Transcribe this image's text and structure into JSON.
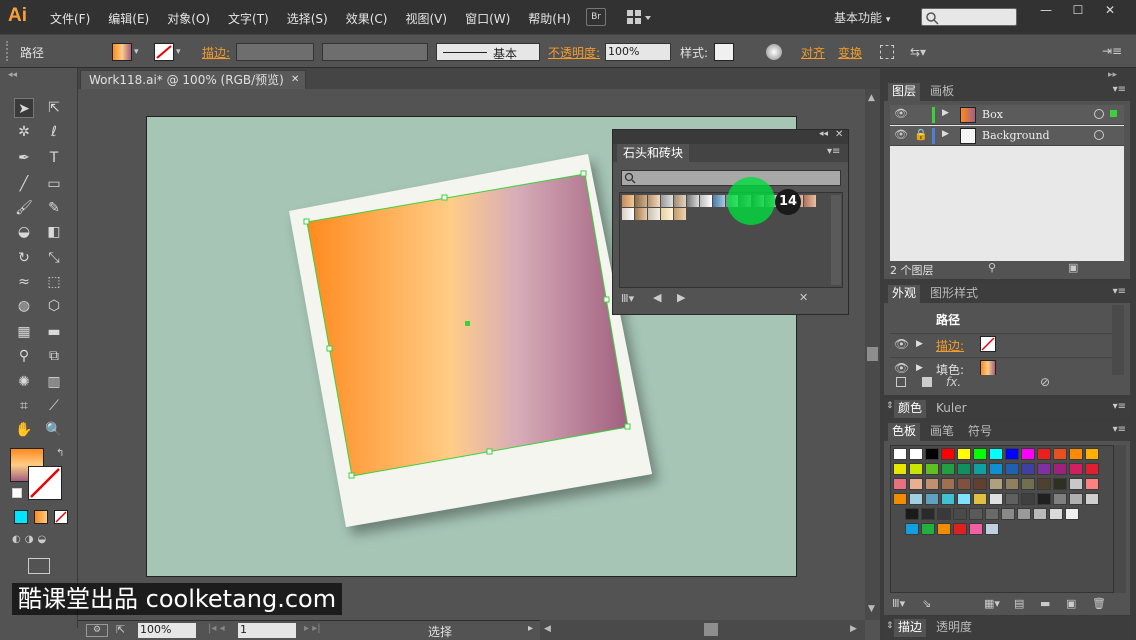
{
  "app": {
    "logo": "Ai",
    "menus": [
      "文件(F)",
      "编辑(E)",
      "对象(O)",
      "文字(T)",
      "选择(S)",
      "效果(C)",
      "视图(V)",
      "窗口(W)",
      "帮助(H)"
    ],
    "bridge_label": "Br",
    "workspace": "基本功能",
    "window_controls": [
      "—",
      "☐",
      "✕"
    ]
  },
  "control_bar": {
    "selection_type": "路径",
    "stroke_label": "描边:",
    "stroke_style": "基本",
    "opacity_label": "不透明度:",
    "opacity_value": "100%",
    "style_label": "样式:",
    "align_label": "对齐",
    "transform_label": "变换"
  },
  "document": {
    "tab_title": "Work118.ai* @ 100% (RGB/预览)",
    "tab_close": "✕"
  },
  "swatch_library_panel": {
    "title": "石头和砖块",
    "search_placeholder": "",
    "callout_number": "14"
  },
  "layers_panel": {
    "tabs": [
      "图层",
      "画板"
    ],
    "layers": [
      {
        "name": "Box",
        "color": "#3cd03c"
      },
      {
        "name": "Background",
        "color": "#4f7fd8"
      }
    ],
    "count_label": "2 个图层"
  },
  "appearance_panel": {
    "tabs": [
      "外观",
      "图形样式"
    ],
    "title": "路径",
    "rows": [
      {
        "label": "描边:",
        "highlight": true
      },
      {
        "label": "填色:",
        "highlight": false
      }
    ],
    "fx_label": "fx."
  },
  "color_panel": {
    "tabs": [
      "颜色",
      "Kuler"
    ]
  },
  "swatches_panel": {
    "tabs": [
      "色板",
      "画笔",
      "符号"
    ]
  },
  "stroke_panel": {
    "tabs": [
      "描边",
      "透明度"
    ]
  },
  "status_bar": {
    "zoom": "100%",
    "page": "1",
    "status": "选择"
  },
  "watermark": {
    "text": "酷课堂出品 coolketang.com"
  },
  "colors": {
    "accent_orange": "#f39c2c",
    "artboard_bg": "#a6c5b5",
    "selection_green": "#3cd03c",
    "gradient_start": "#ff8a1e",
    "gradient_mid": "#ffcd87",
    "gradient_end": "#a0607f"
  }
}
